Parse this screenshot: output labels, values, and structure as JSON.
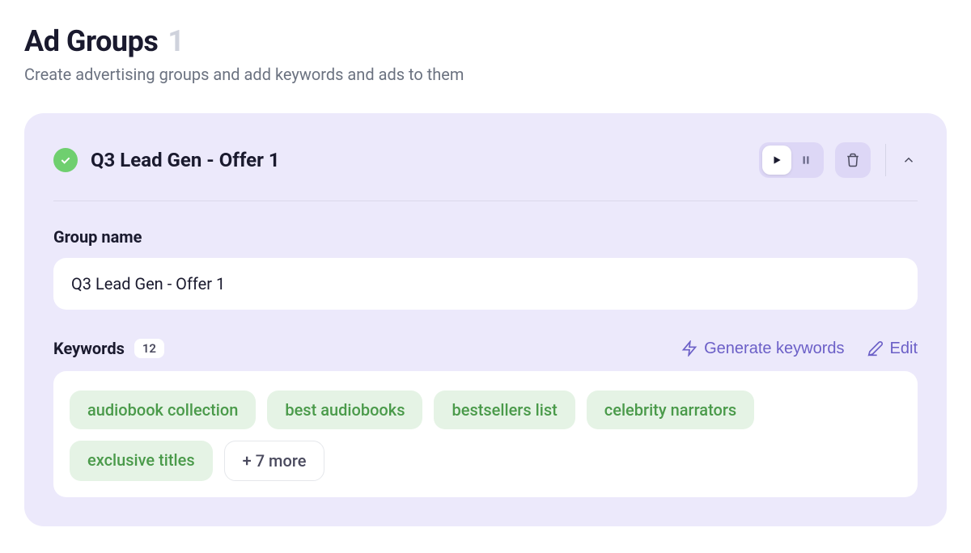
{
  "page": {
    "title": "Ad Groups",
    "count": "1",
    "subtitle": "Create advertising groups and add keywords and ads to them"
  },
  "group": {
    "title": "Q3 Lead Gen - Offer 1",
    "name_label": "Group name",
    "name_value": "Q3 Lead Gen - Offer 1",
    "keywords_label": "Keywords",
    "keywords_count": "12",
    "generate_label": "Generate keywords",
    "edit_label": "Edit",
    "keywords": [
      "audiobook collection",
      "best audiobooks",
      "bestsellers list",
      "celebrity narrators",
      "exclusive titles"
    ],
    "more_label": "+ 7 more"
  }
}
